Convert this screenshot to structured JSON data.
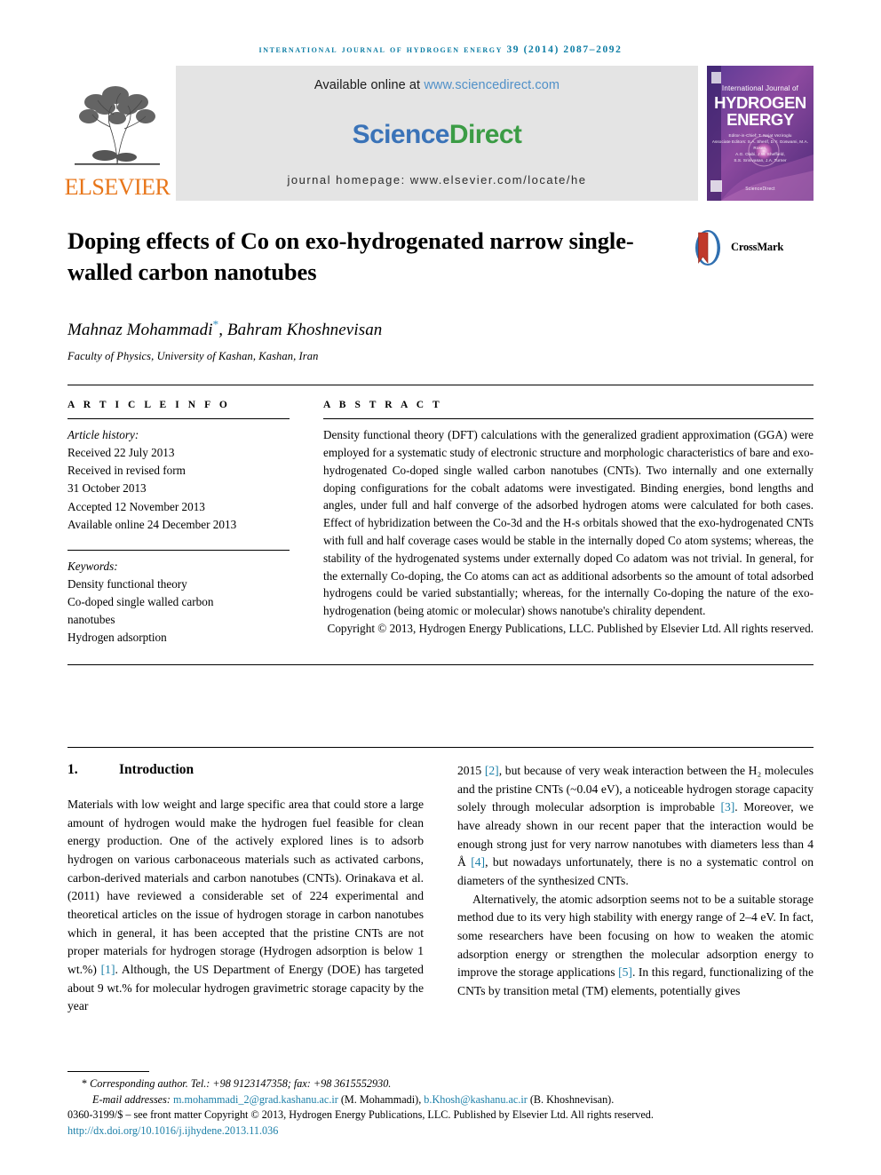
{
  "running_head": "international journal of hydrogen energy 39 (2014) 2087–2092",
  "masthead": {
    "publisher_logo_text": "ELSEVIER",
    "available_online_prefix": "Available online at ",
    "available_online_url": "www.sciencedirect.com",
    "sciencedirect_logo": "ScienceDirect",
    "journal_homepage": "journal homepage: www.elsevier.com/locate/he",
    "cover": {
      "line1": "International Journal of",
      "line2": "HYDROGEN",
      "line3": "ENERGY",
      "editors": "Editor-in-Chief: T. Nejat Veziroglu\nAssociate Editors: S.A. Sherif, D.Y. Goswami, M.A. Rosen,\nA.G. Olabi, J.W. Sheffield,\nS.S. Srinivasan, J.A. Turner",
      "science_direct_mark": "ScienceDirect"
    }
  },
  "article": {
    "title": "Doping effects of Co on exo-hydrogenated narrow single-walled carbon nanotubes",
    "crossmark_label": "CrossMark",
    "authors": "Mahnaz Mohammadi, Bahram Khoshnevisan",
    "author_marker": "*",
    "affiliation": "Faculty of Physics, University of Kashan, Kashan, Iran"
  },
  "article_info": {
    "heading": "A R T I C L E   I N F O",
    "history_label": "Article history:",
    "history": [
      "Received 22 July 2013",
      "Received in revised form",
      "31 October 2013",
      "Accepted 12 November 2013",
      "Available online 24 December 2013"
    ],
    "keywords_label": "Keywords:",
    "keywords": [
      "Density functional theory",
      "Co-doped single walled carbon",
      "nanotubes",
      "Hydrogen adsorption"
    ]
  },
  "abstract": {
    "heading": "A B S T R A C T",
    "text": "Density functional theory (DFT) calculations with the generalized gradient approximation (GGA) were employed for a systematic study of electronic structure and morphologic characteristics of bare and exo-hydrogenated Co-doped single walled carbon nanotubes (CNTs). Two internally and one externally doping configurations for the cobalt adatoms were investigated. Binding energies, bond lengths and angles, under full and half converge of the adsorbed hydrogen atoms were calculated for both cases. Effect of hybridization between the Co-3d and the H-s orbitals showed that the exo-hydrogenated CNTs with full and half coverage cases would be stable in the internally doped Co atom systems; whereas, the stability of the hydrogenated systems under externally doped Co adatom was not trivial. In general, for the externally Co-doping, the Co atoms can act as additional adsorbents so the amount of total adsorbed hydrogens could be varied substantially; whereas, for the internally Co-doping the nature of the exo-hydrogenation (being atomic or molecular) shows nanotube's chirality dependent.",
    "copyright": "Copyright © 2013, Hydrogen Energy Publications, LLC. Published by Elsevier Ltd. All rights reserved."
  },
  "body": {
    "section_number": "1.",
    "section_title": "Introduction",
    "left_column": [
      "Materials with low weight and large specific area that could store a large amount of hydrogen would make the hydrogen fuel feasible for clean energy production. One of the actively explored lines is to adsorb hydrogen on various carbonaceous materials such as activated carbons, carbon-derived materials and carbon nanotubes (CNTs). Orinakava et al. (2011) have reviewed a considerable set of 224 experimental and theoretical articles on the issue of hydrogen storage in carbon nanotubes which in general, it has been accepted that the pristine CNTs are not proper materials for hydrogen storage (Hydrogen adsorption is below 1 wt.%) [1]. Although, the US Department of Energy (DOE) has targeted about 9 wt.% for molecular hydrogen gravimetric storage capacity by the year"
    ],
    "right_column": [
      "2015 [2], but because of very weak interaction between the H₂ molecules and the pristine CNTs (~0.04 eV), a noticeable hydrogen storage capacity solely through molecular adsorption is improbable [3]. Moreover, we have already shown in our recent paper that the interaction would be enough strong just for very narrow nanotubes with diameters less than 4 Å [4], but nowadays unfortunately, there is no a systematic control on diameters of the synthesized CNTs.",
      "Alternatively, the atomic adsorption seems not to be a suitable storage method due to its very high stability with energy range of 2–4 eV. In fact, some researchers have been focusing on how to weaken the atomic adsorption energy or strengthen the molecular adsorption energy to improve the storage applications [5]. In this regard, functionalizing of the CNTs by transition metal (TM) elements, potentially gives"
    ],
    "citations_left": [
      "[1]"
    ],
    "citations_right": [
      "[2]",
      "[3]",
      "[4]",
      "[5]"
    ]
  },
  "footnote": {
    "corresponding_marker": "*",
    "corresponding_text": "Corresponding author. Tel.: +98 9123147358; fax: +98 3615552930.",
    "email_label": "E-mail addresses:",
    "email1": "m.mohammadi_2@grad.kashanu.ac.ir",
    "email1_owner": "(M. Mohammadi)",
    "email2": "b.Khosh@kashanu.ac.ir",
    "email2_owner": "(B. Khoshnevisan)",
    "issn_line": "0360-3199/$ – see front matter Copyright © 2013, Hydrogen Energy Publications, LLC. Published by Elsevier Ltd. All rights reserved.",
    "doi": "http://dx.doi.org/10.1016/j.ijhydene.2013.11.036"
  },
  "colors": {
    "running_head": "#0b7ca4",
    "link": "#1b7fa8",
    "elsevier_orange": "#e8761a",
    "sciencedirect_green": "#3b9c45",
    "sciencedirect_blue": "#3a73b8",
    "masthead_bg": "#e4e4e4"
  }
}
